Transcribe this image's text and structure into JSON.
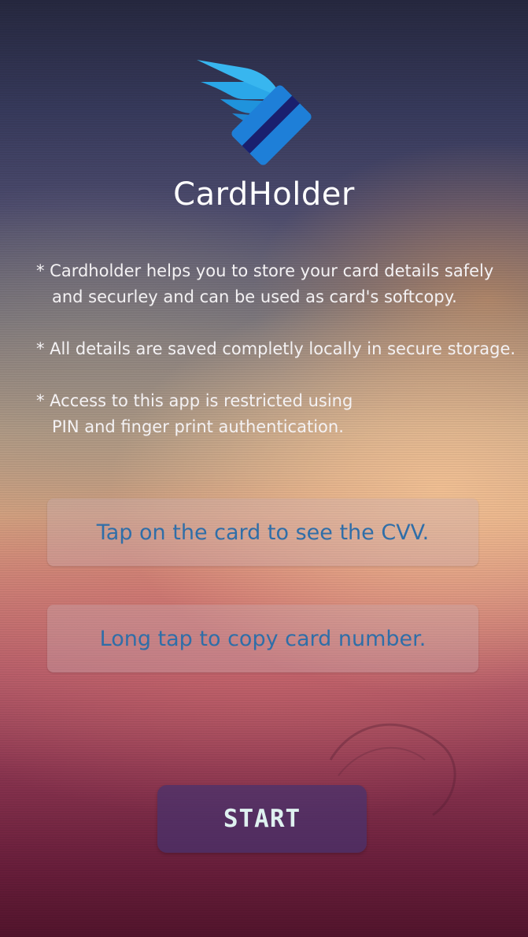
{
  "app": {
    "title": "CardHolder",
    "logo_icon": "winged-card-icon"
  },
  "info": {
    "bullets": [
      {
        "line1": "* Cardholder helps you to store your card details safely",
        "line2": "and securley and can be used as card's softcopy."
      },
      {
        "line1": "* All details are saved completly locally in secure storage.",
        "line2": ""
      },
      {
        "line1": "* Access to this app is restricted using",
        "line2": "PIN and finger print authentication."
      }
    ]
  },
  "hints": [
    {
      "text": "Tap on the card to see the CVV."
    },
    {
      "text": "Long tap to copy card number."
    }
  ],
  "actions": {
    "start_label": "START"
  },
  "colors": {
    "hint_text": "#2f6ea8",
    "start_button_bg": "#46326e",
    "start_text": "#dff1f0",
    "logo_wing": "#2aa7e8",
    "logo_card": "#1e7fd8",
    "logo_stripe": "#1a1f6e"
  }
}
